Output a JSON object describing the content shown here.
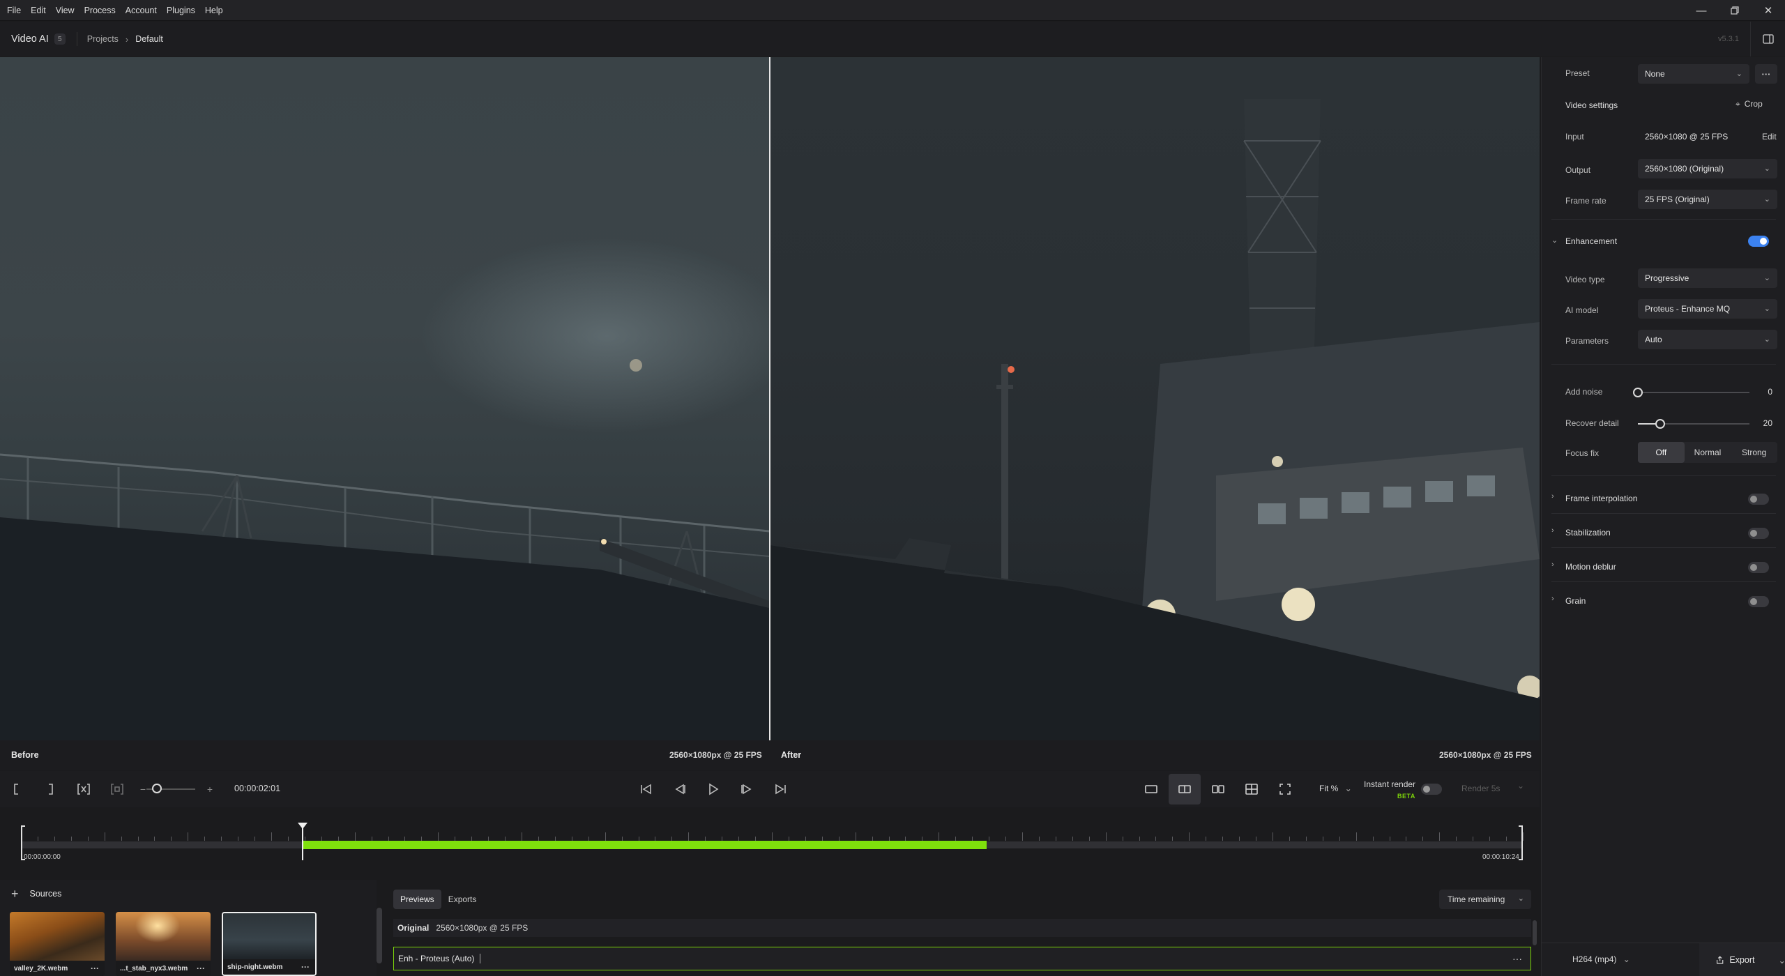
{
  "menubar": {
    "items": [
      "File",
      "Edit",
      "View",
      "Process",
      "Account",
      "Plugins",
      "Help"
    ]
  },
  "header": {
    "app_name": "Video AI",
    "badge": "5",
    "breadcrumb": [
      "Projects",
      "Default"
    ],
    "version": "v5.3.1"
  },
  "viewer": {
    "before_label": "Before",
    "before_res": "2560×1080px @ 25 FPS",
    "after_label": "After",
    "after_res": "2560×1080px @ 25 FPS"
  },
  "controls": {
    "timecode": "00:00:02:01",
    "fit": "Fit %",
    "instant_render": "Instant render",
    "beta": "BETA",
    "render": "Render 5s"
  },
  "timeline": {
    "start": "00:00:00:00",
    "end": "00:00:10:24",
    "playhead_fraction": 0.187,
    "progress_start_fraction": 0.187,
    "progress_end_fraction": 0.643
  },
  "sources": {
    "title": "Sources",
    "items": [
      {
        "name": "valley_2K.webm",
        "selected": false
      },
      {
        "name": "...t_stab_nyx3.webm",
        "selected": false
      },
      {
        "name": "ship-night.webm",
        "selected": true
      }
    ]
  },
  "previews": {
    "tabs": [
      "Previews",
      "Exports"
    ],
    "sort": "Time remaining",
    "original_label": "Original",
    "original_value": "2560×1080px @ 25 FPS",
    "enh_label": "Enh - Proteus (Auto)"
  },
  "panel": {
    "preset_label": "Preset",
    "preset_value": "None",
    "video_settings": "Video settings",
    "crop": "Crop",
    "input_label": "Input",
    "input_value": "2560×1080 @ 25 FPS",
    "edit": "Edit",
    "output_label": "Output",
    "output_value": "2560×1080 (Original)",
    "framerate_label": "Frame rate",
    "framerate_value": "25 FPS (Original)",
    "enhancement": "Enhancement",
    "enhancement_on": true,
    "video_type_label": "Video type",
    "video_type_value": "Progressive",
    "ai_model_label": "AI model",
    "ai_model_value": "Proteus - Enhance MQ",
    "parameters_label": "Parameters",
    "parameters_value": "Auto",
    "add_noise_label": "Add noise",
    "add_noise_value": "0",
    "add_noise_fraction": 0.0,
    "recover_detail_label": "Recover detail",
    "recover_detail_value": "20",
    "recover_detail_fraction": 0.2,
    "focus_fix_label": "Focus fix",
    "focus_fix_options": [
      "Off",
      "Normal",
      "Strong"
    ],
    "focus_fix_selected": "Off",
    "sections": [
      "Frame interpolation",
      "Stabilization",
      "Motion deblur",
      "Grain"
    ],
    "codec": "H264 (mp4)",
    "export": "Export"
  }
}
